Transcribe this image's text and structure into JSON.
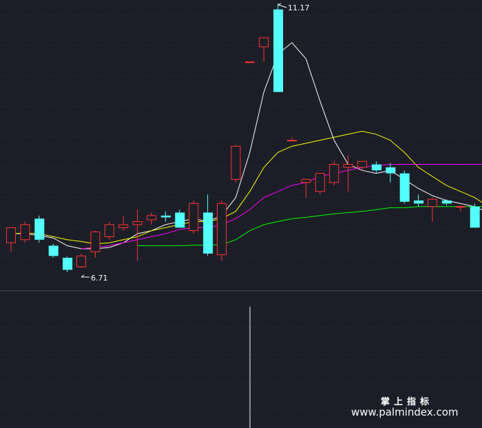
{
  "chart_data": {
    "type": "candlestick",
    "annotations": {
      "high_label": "11.17",
      "low_label": "6.71"
    },
    "candles": [
      {
        "o": 7.2,
        "h": 7.45,
        "l": 7.05,
        "c": 7.45
      },
      {
        "o": 7.25,
        "h": 7.55,
        "l": 7.2,
        "c": 7.5
      },
      {
        "o": 7.6,
        "h": 7.65,
        "l": 7.2,
        "c": 7.25
      },
      {
        "o": 7.15,
        "h": 7.18,
        "l": 6.95,
        "c": 6.98
      },
      {
        "o": 6.95,
        "h": 6.97,
        "l": 6.71,
        "c": 6.75
      },
      {
        "o": 6.8,
        "h": 7.02,
        "l": 6.78,
        "c": 6.98
      },
      {
        "o": 7.05,
        "h": 7.4,
        "l": 6.95,
        "c": 7.38
      },
      {
        "o": 7.3,
        "h": 7.55,
        "l": 7.25,
        "c": 7.5
      },
      {
        "o": 7.45,
        "h": 7.65,
        "l": 7.4,
        "c": 7.5
      },
      {
        "o": 7.5,
        "h": 7.75,
        "l": 6.9,
        "c": 7.55
      },
      {
        "o": 7.58,
        "h": 7.7,
        "l": 7.5,
        "c": 7.65
      },
      {
        "o": 7.65,
        "h": 7.72,
        "l": 7.55,
        "c": 7.62
      },
      {
        "o": 7.7,
        "h": 7.75,
        "l": 7.45,
        "c": 7.45
      },
      {
        "o": 7.4,
        "h": 7.9,
        "l": 7.35,
        "c": 7.85
      },
      {
        "o": 7.7,
        "h": 8.0,
        "l": 6.98,
        "c": 7.02
      },
      {
        "o": 7.0,
        "h": 7.9,
        "l": 6.9,
        "c": 7.85
      },
      {
        "o": 8.25,
        "h": 8.82,
        "l": 8.2,
        "c": 8.8
      },
      {
        "o": 10.2,
        "h": 10.2,
        "l": 10.2,
        "c": 10.2
      },
      {
        "o": 10.45,
        "h": 10.6,
        "l": 10.2,
        "c": 10.6
      },
      {
        "o": 11.07,
        "h": 11.17,
        "l": 9.7,
        "c": 9.7
      },
      {
        "o": 8.9,
        "h": 8.95,
        "l": 8.88,
        "c": 8.9
      },
      {
        "o": 8.2,
        "h": 8.25,
        "l": 7.95,
        "c": 8.25
      },
      {
        "o": 8.05,
        "h": 8.35,
        "l": 8.0,
        "c": 8.35
      },
      {
        "o": 8.2,
        "h": 8.55,
        "l": 8.15,
        "c": 8.5
      },
      {
        "o": 8.45,
        "h": 8.65,
        "l": 8.05,
        "c": 8.5
      },
      {
        "o": 8.45,
        "h": 8.55,
        "l": 8.4,
        "c": 8.55
      },
      {
        "o": 8.5,
        "h": 8.55,
        "l": 8.35,
        "c": 8.4
      },
      {
        "o": 8.45,
        "h": 8.52,
        "l": 8.2,
        "c": 8.35
      },
      {
        "o": 8.35,
        "h": 8.4,
        "l": 7.85,
        "c": 7.88
      },
      {
        "o": 7.9,
        "h": 8.0,
        "l": 7.8,
        "c": 7.85
      },
      {
        "o": 7.8,
        "h": 7.95,
        "l": 7.55,
        "c": 7.92
      },
      {
        "o": 7.9,
        "h": 7.92,
        "l": 7.82,
        "c": 7.85
      },
      {
        "o": 7.8,
        "h": 7.82,
        "l": 7.72,
        "c": 7.8
      },
      {
        "o": 7.8,
        "h": 7.85,
        "l": 7.45,
        "c": 7.45
      },
      {
        "o": 7.45,
        "h": 7.6,
        "l": 7.3,
        "c": 7.55
      }
    ],
    "ma": [
      {
        "color": "#ffffff",
        "values": [
          7.35,
          7.35,
          7.32,
          7.28,
          7.15,
          7.1,
          7.1,
          7.12,
          7.2,
          7.35,
          7.4,
          7.5,
          7.55,
          7.6,
          7.55,
          7.65,
          7.95,
          8.7,
          9.7,
          10.33,
          10.52,
          10.25,
          9.55,
          8.9,
          8.5,
          8.4,
          8.35,
          8.4,
          8.25,
          8.1,
          7.98,
          7.9,
          7.85,
          7.8,
          7.7
        ]
      },
      {
        "color": "#ffff00",
        "values": [
          7.35,
          7.36,
          7.35,
          7.3,
          7.25,
          7.22,
          7.18,
          7.2,
          7.25,
          7.3,
          7.4,
          7.45,
          7.5,
          7.55,
          7.55,
          7.6,
          7.72,
          8.05,
          8.45,
          8.7,
          8.8,
          8.85,
          8.9,
          8.95,
          9.0,
          9.05,
          9.0,
          8.9,
          8.7,
          8.45,
          8.3,
          8.15,
          8.05,
          7.95,
          7.8
        ]
      },
      {
        "color": "#ff00ff",
        "values": [
          null,
          null,
          null,
          null,
          null,
          7.1,
          7.12,
          7.15,
          7.2,
          7.25,
          7.3,
          7.35,
          7.42,
          7.45,
          7.45,
          7.5,
          7.6,
          7.75,
          7.95,
          8.05,
          8.15,
          8.2,
          8.3,
          8.35,
          8.4,
          8.45,
          8.48,
          8.5,
          8.5,
          8.5,
          8.5,
          8.5,
          8.5,
          8.5,
          8.5
        ]
      },
      {
        "color": "#00ff00",
        "values": [
          null,
          null,
          null,
          null,
          null,
          null,
          null,
          null,
          null,
          7.15,
          7.15,
          7.15,
          7.15,
          7.16,
          7.16,
          7.17,
          7.25,
          7.4,
          7.5,
          7.55,
          7.6,
          7.62,
          7.65,
          7.68,
          7.7,
          7.72,
          7.75,
          7.78,
          7.78,
          7.8,
          7.8,
          7.8,
          7.8,
          7.8,
          7.8
        ]
      }
    ],
    "colors": {
      "up": "#ff3232",
      "down": "#54ffff",
      "background": "#1b1e26",
      "grid": "#3a3f4a"
    }
  },
  "watermark": {
    "line1": "掌上指标",
    "line2": "www.palmindex.com"
  }
}
